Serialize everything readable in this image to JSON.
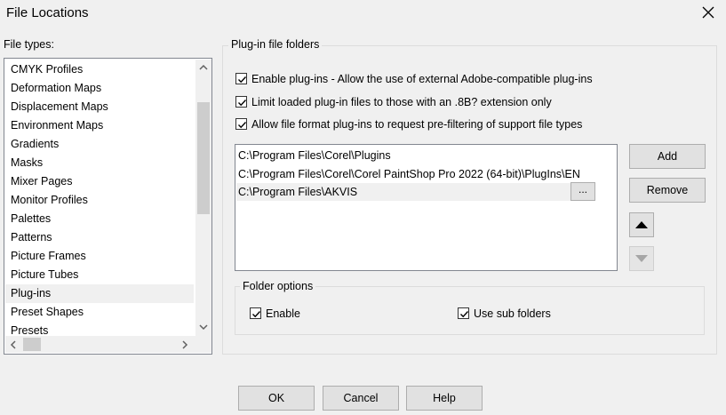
{
  "window": {
    "title": "File Locations"
  },
  "file_types": {
    "label": "File types:",
    "items": [
      {
        "label": "CMYK Profiles"
      },
      {
        "label": "Deformation Maps"
      },
      {
        "label": "Displacement Maps"
      },
      {
        "label": "Environment Maps"
      },
      {
        "label": "Gradients"
      },
      {
        "label": "Masks"
      },
      {
        "label": "Mixer Pages"
      },
      {
        "label": "Monitor Profiles"
      },
      {
        "label": "Palettes"
      },
      {
        "label": "Patterns"
      },
      {
        "label": "Picture Frames"
      },
      {
        "label": "Picture Tubes"
      },
      {
        "label": "Plug-ins"
      },
      {
        "label": "Preset Shapes"
      },
      {
        "label": "Presets"
      }
    ],
    "selected": "Plug-ins"
  },
  "plugin_group": {
    "legend": "Plug-in file folders",
    "options": [
      {
        "label": "Enable plug-ins - Allow the use of external Adobe-compatible plug-ins",
        "checked": true
      },
      {
        "label": "Limit loaded plug-in files to those with an .8B? extension only",
        "checked": true
      },
      {
        "label": "Allow file format plug-ins to request pre-filtering of support file types",
        "checked": true
      }
    ],
    "folders": [
      {
        "path": "C:\\Program Files\\Corel\\Plugins"
      },
      {
        "path": "C:\\Program Files\\Corel\\Corel PaintShop Pro 2022 (64-bit)\\PlugIns\\EN"
      },
      {
        "path": "C:\\Program Files\\AKVIS"
      }
    ],
    "browse_label": "...",
    "add_label": "Add",
    "remove_label": "Remove",
    "folder_options": {
      "legend": "Folder options",
      "enable_label": "Enable",
      "enable_checked": true,
      "subfolders_label": "Use sub folders",
      "subfolders_checked": true
    }
  },
  "buttons": {
    "ok": "OK",
    "cancel": "Cancel",
    "help": "Help"
  },
  "icons": {
    "close": "close-icon",
    "move_up": "triangle-up-icon",
    "move_down": "triangle-down-icon",
    "check": "checkmark-icon"
  }
}
